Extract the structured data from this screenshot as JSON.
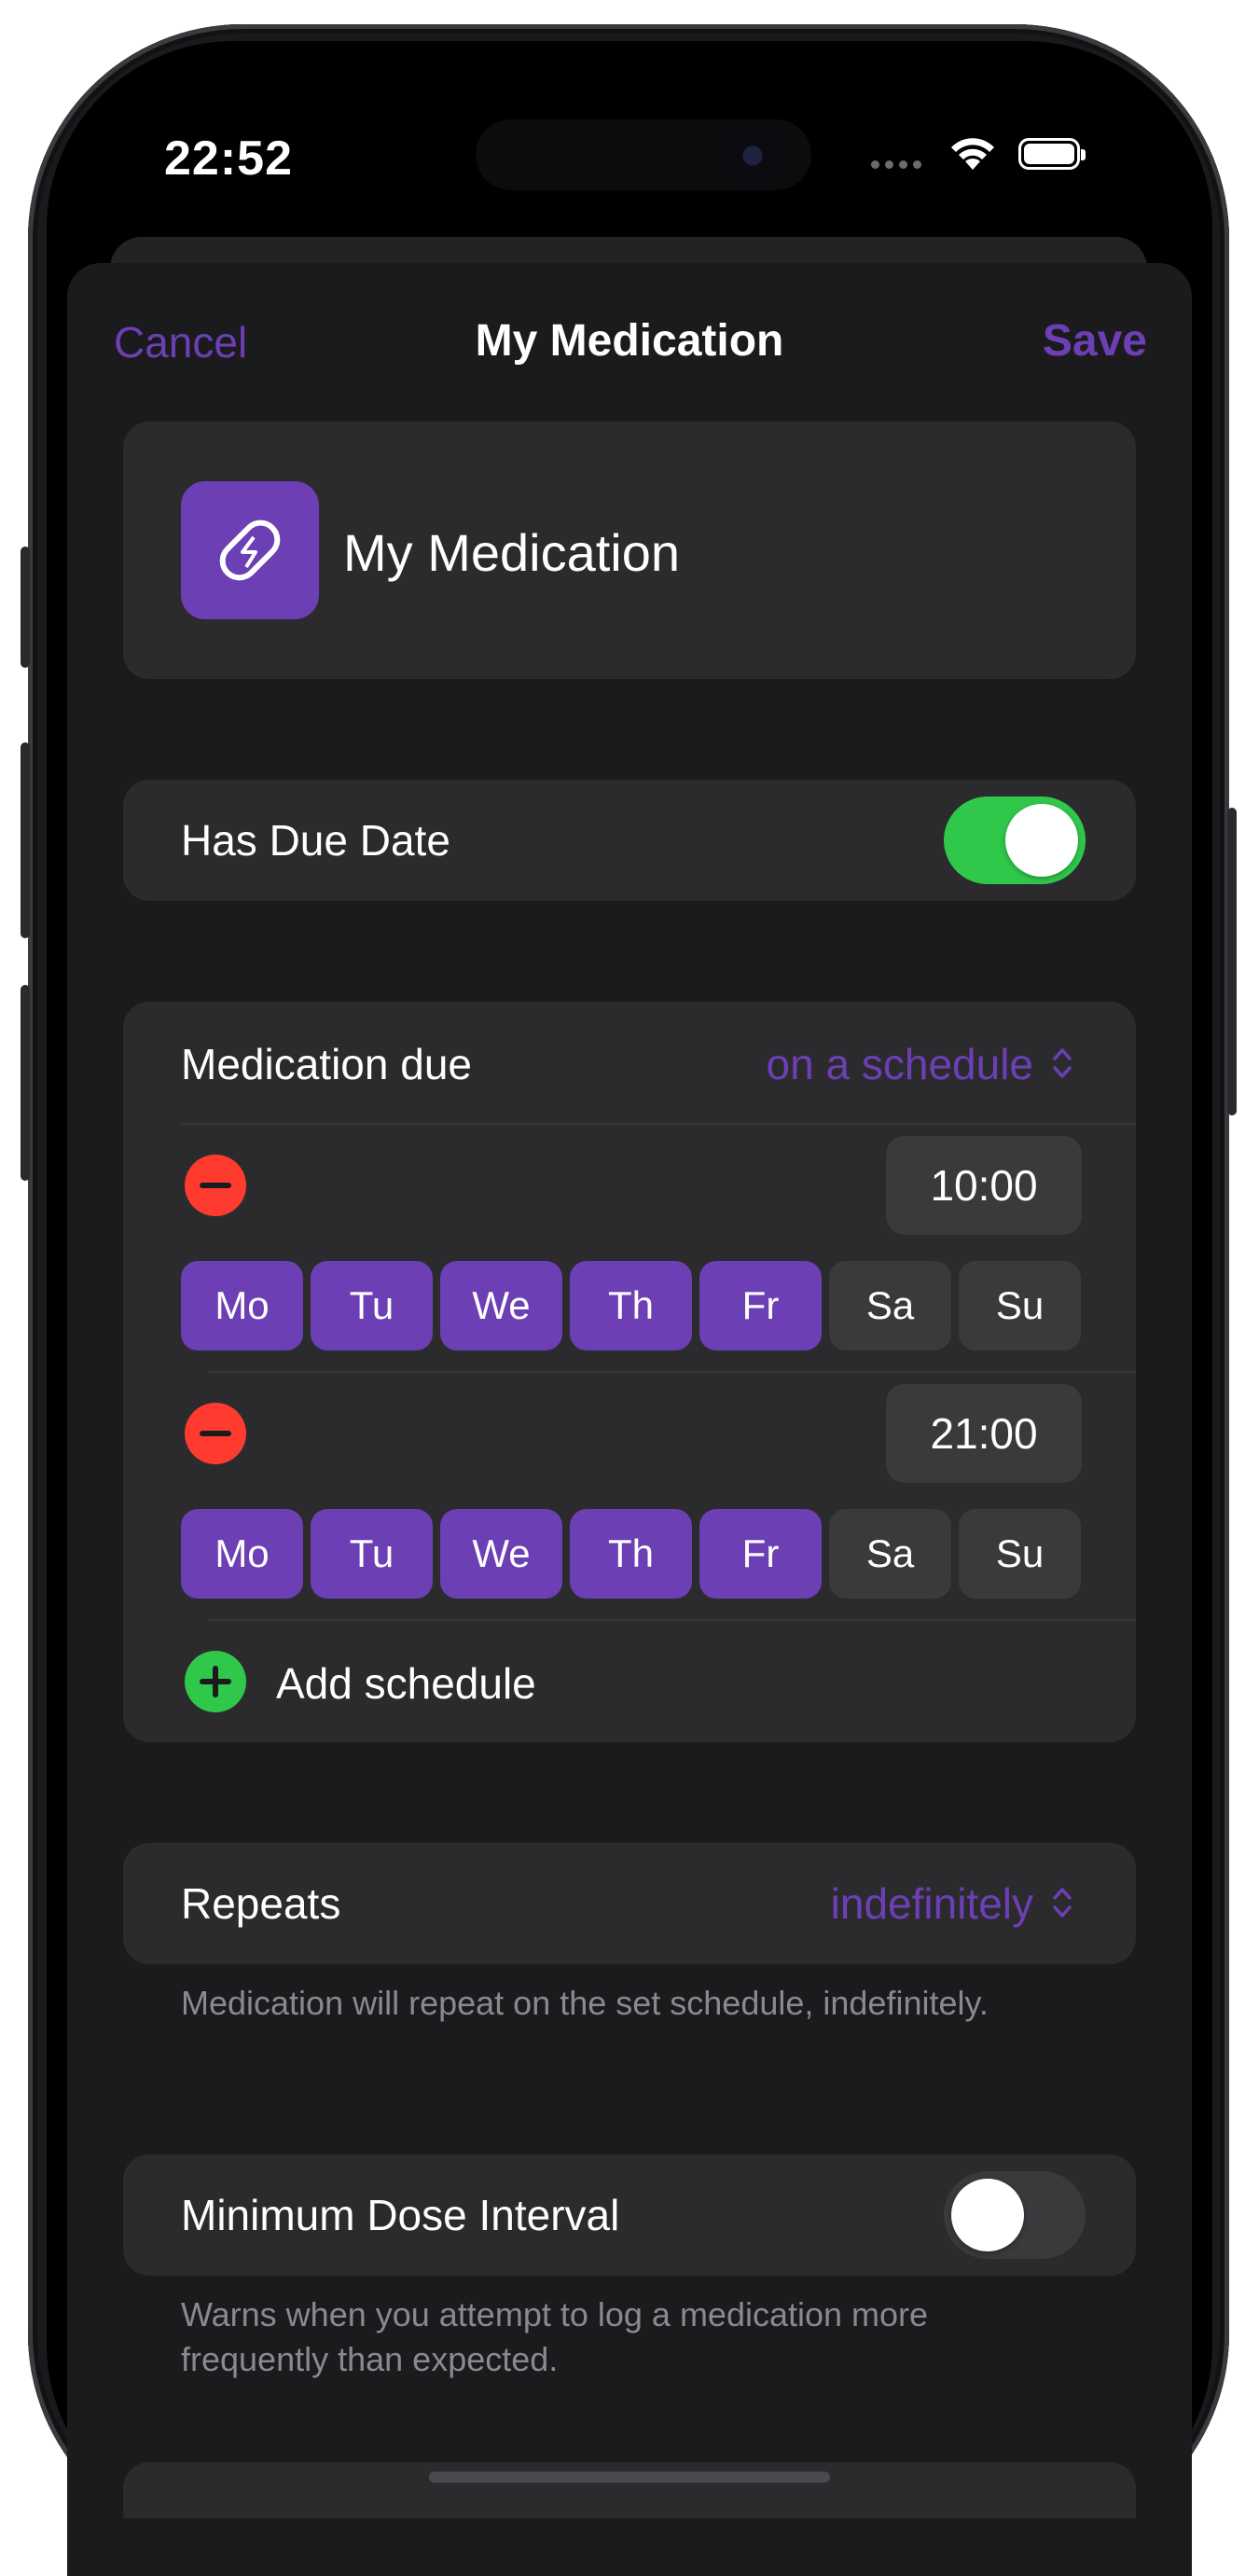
{
  "status_bar": {
    "time": "22:52"
  },
  "nav": {
    "cancel_label": "Cancel",
    "title": "My Medication",
    "save_label": "Save"
  },
  "medication": {
    "name": "My Medication",
    "icon": "pill-icon"
  },
  "due_date": {
    "label": "Has Due Date",
    "enabled": true
  },
  "schedule": {
    "label": "Medication due",
    "mode": "on a schedule",
    "entries": [
      {
        "time": "10:00",
        "days": [
          {
            "label": "Mo",
            "selected": true
          },
          {
            "label": "Tu",
            "selected": true
          },
          {
            "label": "We",
            "selected": true
          },
          {
            "label": "Th",
            "selected": true
          },
          {
            "label": "Fr",
            "selected": true
          },
          {
            "label": "Sa",
            "selected": false
          },
          {
            "label": "Su",
            "selected": false
          }
        ]
      },
      {
        "time": "21:00",
        "days": [
          {
            "label": "Mo",
            "selected": true
          },
          {
            "label": "Tu",
            "selected": true
          },
          {
            "label": "We",
            "selected": true
          },
          {
            "label": "Th",
            "selected": true
          },
          {
            "label": "Fr",
            "selected": true
          },
          {
            "label": "Sa",
            "selected": false
          },
          {
            "label": "Su",
            "selected": false
          }
        ]
      }
    ],
    "add_label": "Add schedule"
  },
  "repeats": {
    "label": "Repeats",
    "value": "indefinitely",
    "footnote": "Medication will repeat on the set schedule, indefinitely."
  },
  "min_interval": {
    "label": "Minimum Dose Interval",
    "enabled": false,
    "footnote": "Warns when you attempt to log a medication more frequently than expected."
  },
  "colors": {
    "accent": "#6c3fb5",
    "toggle_on": "#30c84b",
    "delete": "#ff3b30",
    "add": "#30c84b",
    "sheet": "#1b1b1d",
    "cell": "#2b2b2e"
  }
}
